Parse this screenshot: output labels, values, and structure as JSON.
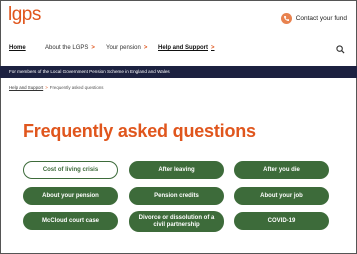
{
  "header": {
    "logo": "lgps",
    "contact_label": "Contact your fund",
    "contact_icon": "phone-icon"
  },
  "nav": {
    "items": [
      {
        "label": "Home",
        "chevron": ""
      },
      {
        "label": "About the LGPS",
        "chevron": ">"
      },
      {
        "label": "Your pension",
        "chevron": ">"
      },
      {
        "label": "Help and Support",
        "chevron": ">"
      }
    ],
    "search_icon": "search-icon"
  },
  "banner": {
    "text": "For members of the Local Government Pension Scheme in England and Wales"
  },
  "breadcrumb": {
    "parent": "Help and Support",
    "separator": ">",
    "current": "Frequently asked questions"
  },
  "page": {
    "title": "Frequently asked questions"
  },
  "faq_buttons": [
    {
      "label": "Cost of living crisis"
    },
    {
      "label": "After leaving"
    },
    {
      "label": "After you die"
    },
    {
      "label": "About your pension"
    },
    {
      "label": "Pension credits"
    },
    {
      "label": "About your job"
    },
    {
      "label": "McCloud court case"
    },
    {
      "label": "Divorce or dissolution of a civil partnership"
    },
    {
      "label": "COVID-19"
    }
  ],
  "colors": {
    "accent": "#e0561d",
    "banner": "#1c2140",
    "button": "#3d6b3a"
  }
}
